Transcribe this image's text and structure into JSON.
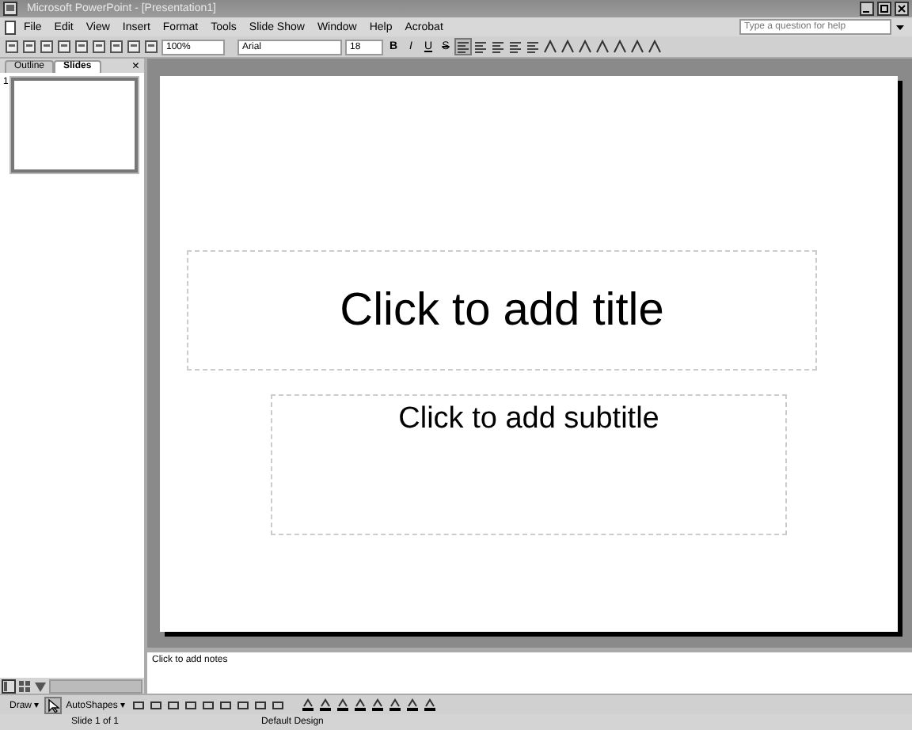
{
  "window": {
    "title": "Microsoft PowerPoint - [Presentation1]"
  },
  "menu": [
    "File",
    "Edit",
    "View",
    "Insert",
    "Format",
    "Tools",
    "Slide Show",
    "Window",
    "Help",
    "Acrobat"
  ],
  "help": {
    "placeholder": "Type a question for help"
  },
  "toolbar": {
    "zoom": "100%",
    "font": "Arial",
    "size": "18",
    "format_buttons": [
      "B",
      "I",
      "U",
      "S"
    ]
  },
  "panel_tabs": [
    {
      "label": "Outline",
      "selected": false
    },
    {
      "label": "Slides",
      "selected": true
    }
  ],
  "panel_close": "×",
  "thumbnails": [
    {
      "number": "1",
      "selected": true
    }
  ],
  "slide": {
    "title": "Click to add title",
    "subtitle": "Click to add subtitle"
  },
  "notes": {
    "placeholder": "Click to add notes"
  },
  "drawing_toolbar": {
    "draw": "Draw ▾",
    "autoshapes": "AutoShapes ▾"
  },
  "status_bar": [
    "Slide 1 of 1",
    "Default Design"
  ]
}
